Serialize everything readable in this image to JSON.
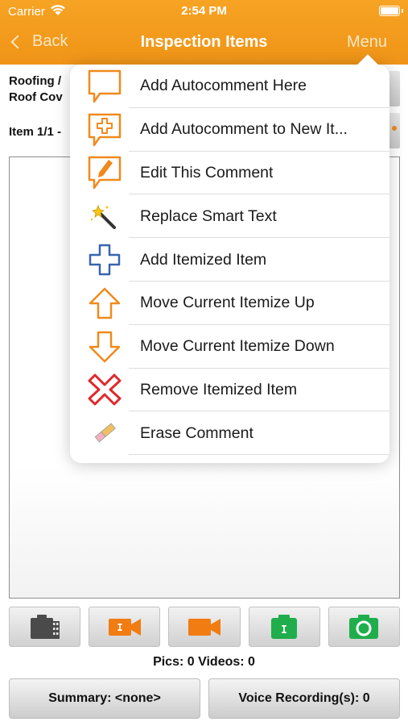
{
  "status_bar": {
    "carrier": "Carrier",
    "time": "2:54 PM"
  },
  "nav": {
    "back_label": "Back",
    "title": "Inspection Items",
    "menu_label": "Menu"
  },
  "content": {
    "breadcrumb_line1": "Roofing /",
    "breadcrumb_line2": "Roof Cov",
    "item_counter": "Item 1/1 -"
  },
  "toolbar": {
    "buttons": [
      {
        "icon": "photo-gallery-icon"
      },
      {
        "icon": "video-text-icon"
      },
      {
        "icon": "video-camera-icon"
      },
      {
        "icon": "camera-text-icon"
      },
      {
        "icon": "camera-icon"
      }
    ]
  },
  "media_counts": "Pics: 0 Videos: 0",
  "bottom_buttons": {
    "summary": "Summary: <none>",
    "voice": "Voice Recording(s): 0"
  },
  "menu": {
    "items": [
      {
        "label": "Add Autocomment Here",
        "icon": "comment-bubble-icon"
      },
      {
        "label": "Add Autocomment to New It...",
        "icon": "comment-plus-icon"
      },
      {
        "label": "Edit This Comment",
        "icon": "comment-pencil-icon"
      },
      {
        "label": "Replace Smart Text",
        "icon": "magic-wand-icon"
      },
      {
        "label": "Add Itemized Item",
        "icon": "plus-outline-icon"
      },
      {
        "label": "Move Current Itemize Up",
        "icon": "arrow-up-icon"
      },
      {
        "label": "Move Current Itemize Down",
        "icon": "arrow-down-icon"
      },
      {
        "label": "Remove Itemized Item",
        "icon": "remove-x-icon"
      },
      {
        "label": "Erase Comment",
        "icon": "eraser-icon"
      }
    ]
  },
  "colors": {
    "header_orange": "#F29A1E",
    "icon_orange": "#F08A1C",
    "icon_blue": "#3A63B0",
    "icon_red": "#E0282C",
    "icon_green": "#1FAE4B"
  }
}
